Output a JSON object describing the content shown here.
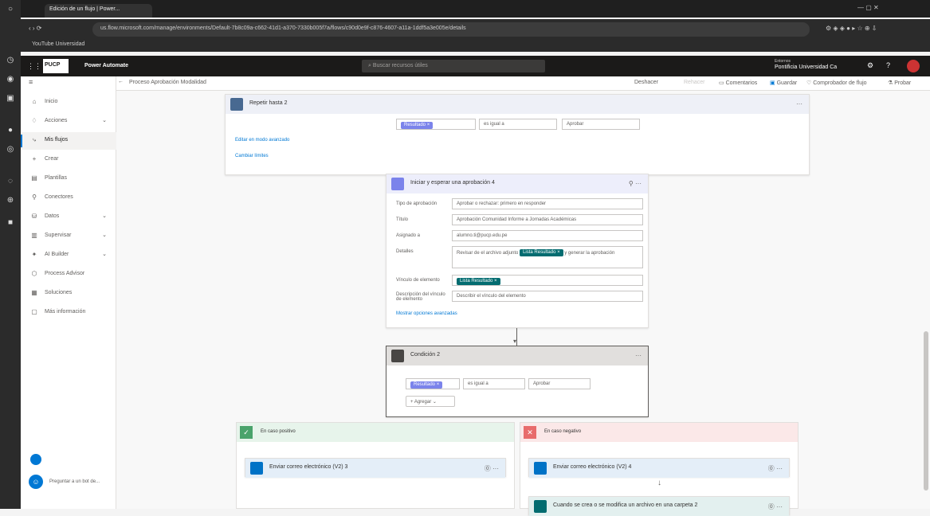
{
  "browser": {
    "tab_title": "Edición de un flujo | Power...",
    "url": "us.flow.microsoft.com/manage/environments/Default-7b8c09a-c662-41d1-a370-7330b005f7a/flows/c90d0e9f-c876-4607-a11a-1ddf5a3e005e/details",
    "bookmarks": "YouTube   Universidad"
  },
  "app": {
    "name": "Power Automate",
    "search_placeholder": "Buscar recursos útiles",
    "environment": "Pontificia Universidad Ca",
    "environment_label": "Entornos"
  },
  "breadcrumb": "Proceso Aprobación Modalidad",
  "toolbar": {
    "undo": "Deshacer",
    "redo": "Rehacer",
    "comments": "Comentarios",
    "save": "Guardar",
    "checker": "Comprobador de flujo",
    "test": "Probar"
  },
  "sidebar": {
    "items": [
      {
        "icon": "home-icon",
        "label": "Inicio"
      },
      {
        "icon": "bell-icon",
        "label": "Acciones"
      },
      {
        "icon": "flow-icon",
        "label": "Mis flujos",
        "selected": true
      },
      {
        "icon": "plus-icon",
        "label": "Crear"
      },
      {
        "icon": "template-icon",
        "label": "Plantillas"
      },
      {
        "icon": "connector-icon",
        "label": "Conectores"
      },
      {
        "icon": "data-icon",
        "label": "Datos"
      },
      {
        "icon": "monitor-icon",
        "label": "Supervisar"
      },
      {
        "icon": "ai-icon",
        "label": "AI Builder"
      },
      {
        "icon": "process-icon",
        "label": "Process Advisor"
      },
      {
        "icon": "solutions-icon",
        "label": "Soluciones"
      },
      {
        "icon": "info-icon",
        "label": "Más información"
      }
    ],
    "ask_bot": "Preguntar a un bot de..."
  },
  "repeat_card": {
    "title": "Repetir hasta 2",
    "token": "Resultado",
    "operator": "es igual a",
    "value": "Aprobar",
    "advanced": "Editar en modo avanzado",
    "limits": "Cambiar límites"
  },
  "approval_card": {
    "title": "Iniciar y esperar una aprobación 4",
    "fields": [
      {
        "label": "Tipo de aprobación",
        "value": "Aprobar o rechazar: primero en responder"
      },
      {
        "label": "Título",
        "value": "Aprobación Comunidad Informe a Jornadas Académicas"
      },
      {
        "label": "Asignado a",
        "value": "alumno.ti@pucp.edu.pe"
      },
      {
        "label": "Detalles",
        "value": "Revisar de el archivo adjunto",
        "token": "Lista Resultado"
      },
      {
        "label": "Vínculo de elemento",
        "token": "Lista Resultado"
      },
      {
        "label": "Descripción del vínculo de elemento",
        "placeholder": "Describir el vínculo del elemento"
      }
    ],
    "details_suffix": "y generar la aprobación",
    "advanced": "Mostrar opciones avanzadas"
  },
  "condition_card": {
    "title": "Condición 2",
    "token": "Resultado",
    "operator": "es igual a",
    "value": "Aprobar",
    "add": "Agregar"
  },
  "branches": {
    "yes": {
      "title": "En caso positivo",
      "action": "Enviar correo electrónico (V2) 3"
    },
    "no": {
      "title": "En caso negativo",
      "action": "Enviar correo electrónico (V2) 4",
      "action2": "Cuando se crea o se modifica un archivo en una carpeta 2"
    }
  },
  "colors": {
    "accent": "#0078d4",
    "approval": "#7b83eb",
    "condition": "#484644",
    "yes": "#4aa36b",
    "no": "#e86c6c",
    "outlook": "#0072c6",
    "sharepoint": "#036c70"
  }
}
